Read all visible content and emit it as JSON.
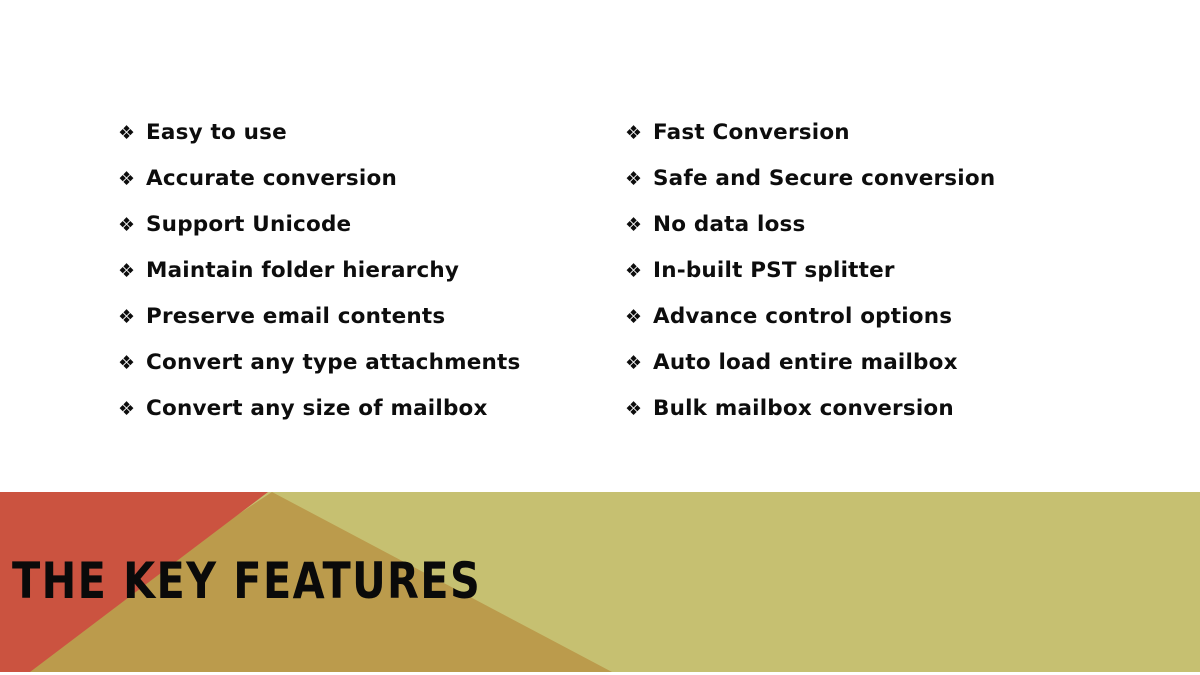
{
  "slide": {
    "title": "THE KEY FEATURES",
    "background_color": "#FFFFFF",
    "text_color": "#0D0D0D"
  },
  "bullet_glyph": "❖",
  "columns": {
    "left": {
      "items": [
        {
          "label": "Easy to use"
        },
        {
          "label": "Accurate conversion"
        },
        {
          "label": "Support Unicode"
        },
        {
          "label": "Maintain folder hierarchy"
        },
        {
          "label": "Preserve email contents"
        },
        {
          "label": "Convert any type attachments"
        },
        {
          "label": "Convert any size of mailbox"
        }
      ]
    },
    "right": {
      "items": [
        {
          "label": "Fast Conversion"
        },
        {
          "label": "Safe and Secure conversion"
        },
        {
          "label": "No data loss"
        },
        {
          "label": "In-built PST splitter"
        },
        {
          "label": "Advance control options"
        },
        {
          "label": "Auto load entire mailbox"
        },
        {
          "label": "Bulk mailbox conversion"
        }
      ]
    }
  },
  "decoration": {
    "khaki_color": "#C6C071",
    "gold_color": "#BB9B4C",
    "red_color": "#CB5340"
  }
}
